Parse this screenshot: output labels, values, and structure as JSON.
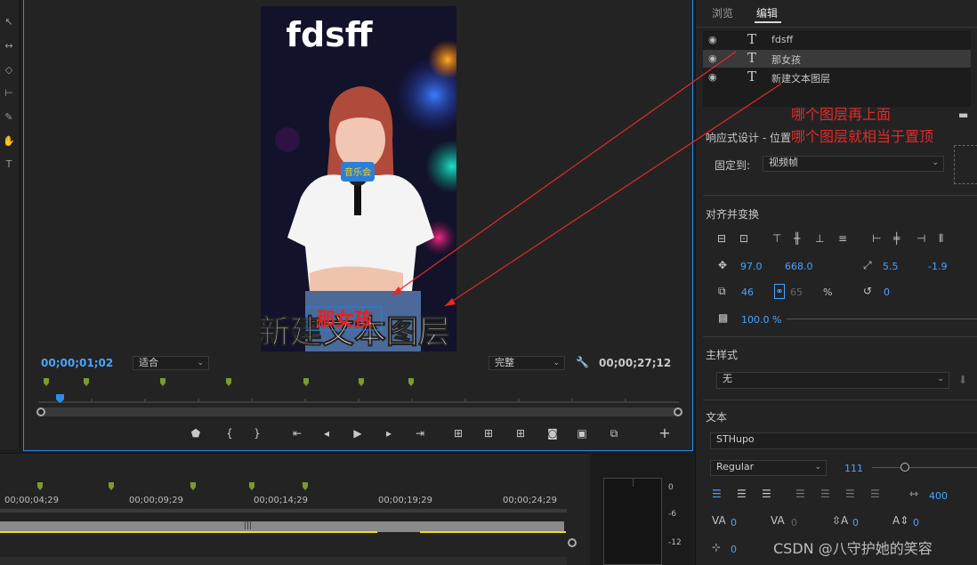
{
  "monitor": {
    "current_timecode": "00;00;01;02",
    "fit_select": "适合",
    "quality_select": "完整",
    "duration_timecode": "00;00;27;12"
  },
  "video": {
    "top_text": "fdsff",
    "middle_text": "那女孩",
    "bottom_text": "新建文本图层",
    "mic_badge": "音乐会"
  },
  "timeline": {
    "ticks": [
      "00;00;04;29",
      "00;00;09;29",
      "00;00;14;29",
      "00;00;19;29",
      "00;00;24;29"
    ]
  },
  "meter": {
    "scale": [
      "0",
      "-6",
      "-12"
    ]
  },
  "right_panel": {
    "tabs": [
      "浏览",
      "编辑"
    ],
    "layers": [
      "fdsff",
      "那女孩",
      "新建文本图层"
    ],
    "responsive_title": "响应式设计 - 位置",
    "pin_label": "固定到:",
    "pin_value": "视频帧",
    "align_title": "对齐并变换",
    "position_x": "97.0",
    "position_y": "668.0",
    "anchor_x": "5.5",
    "anchor_y": "-1.9",
    "scale_w": "46",
    "scale_h": "65",
    "percent_sign": "%",
    "rotation": "0",
    "opacity": "100.0 %",
    "master_style_title": "主样式",
    "master_style_value": "无",
    "text_title": "文本",
    "font_name": "STHupo",
    "font_style": "Regular",
    "font_size": "111",
    "tracking": "400",
    "kerning": "0",
    "kerning2": "0",
    "leading": "0",
    "baseline": "0",
    "tsume": "0"
  },
  "annotation": {
    "line1": "哪个图层再上面",
    "line2": "哪个图层就相当于置顶",
    "color": "#e42a2a"
  },
  "watermark": "CSDN @八守护她的笑容"
}
